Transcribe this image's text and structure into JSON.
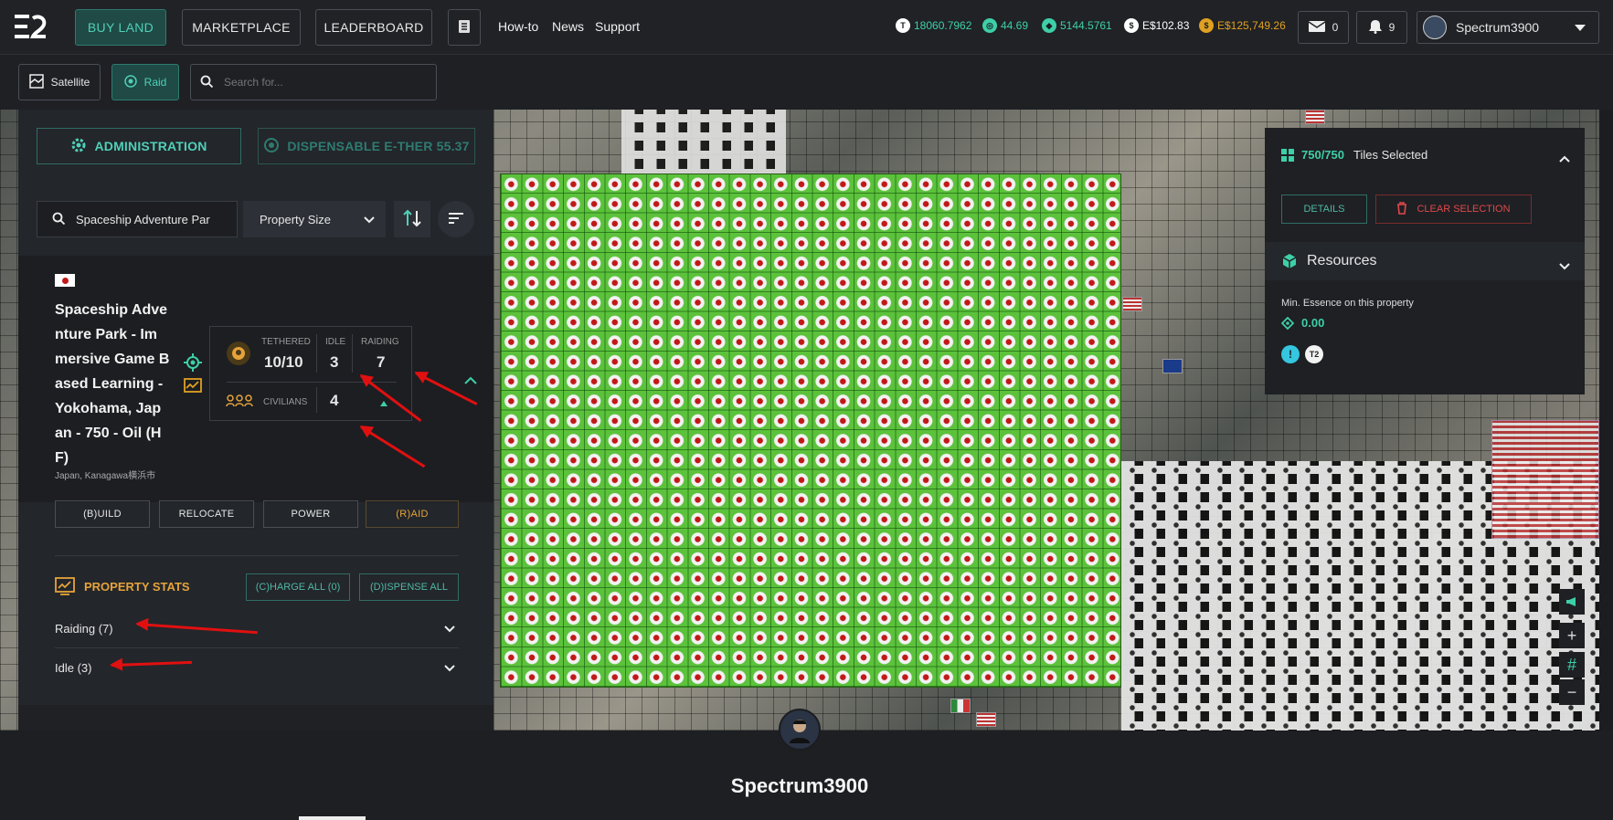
{
  "nav": {
    "logo": "E2",
    "buy_land": "BUY LAND",
    "marketplace": "MARKETPLACE",
    "leaderboard": "LEADERBOARD",
    "howto": "How-to",
    "news": "News",
    "support": "Support",
    "balances": [
      {
        "icon": "tile-token-icon",
        "badge": "T",
        "value": "18060.7962",
        "color": "#3ecfa8"
      },
      {
        "icon": "gem-token-icon",
        "badge": "◎",
        "value": "44.69",
        "color": "#3ecfa8"
      },
      {
        "icon": "essence-icon",
        "badge": "◆",
        "value": "5144.5761",
        "color": "#3ecfa8"
      },
      {
        "icon": "dollar-icon",
        "badge": "$",
        "value": "E$102.83",
        "color": "#ffffff"
      },
      {
        "icon": "gold-coin-icon",
        "badge": "$",
        "value": "E$125,749.26",
        "color": "#e0a020"
      }
    ],
    "mail_count": "0",
    "notif_count": "9",
    "username": "Spectrum3900"
  },
  "subbar": {
    "satellite": "Satellite",
    "raid": "Raid",
    "search_placeholder": "Search for..."
  },
  "panel": {
    "administration": "ADMINISTRATION",
    "dispensable": "DISPENSABLE E-THER 55.37",
    "search_value": "Spaceship Adventure Par",
    "size_select": "Property Size",
    "property": {
      "title_lines": [
        "Spaceship Adve",
        "nture Park - Im",
        "mersive Game B",
        "ased Learning -",
        "Yokohama, Jap",
        "an - 750 - Oil (H",
        "F)"
      ],
      "location": "Japan, Kanagawa横浜市"
    },
    "stats": {
      "tethered_label": "TETHERED",
      "tethered": "10/10",
      "idle_label": "IDLE",
      "idle": "3",
      "raiding_label": "RAIDING",
      "raiding": "7",
      "civilians_label": "CIVILIANS",
      "civilians": "4"
    },
    "actions": {
      "build": "(B)UILD",
      "relocate": "RELOCATE",
      "power": "POWER",
      "raid": "(R)AID"
    },
    "property_stats": "PROPERTY STATS",
    "charge_all": "(C)HARGE ALL (0)",
    "dispense_all": "(D)ISPENSE ALL",
    "rows": [
      {
        "label": "Raiding (7)"
      },
      {
        "label": "Idle (3)"
      }
    ]
  },
  "right": {
    "tiles_count": "750/750",
    "tiles_label": "Tiles Selected",
    "details": "DETAILS",
    "clear": "CLEAR SELECTION",
    "resources": "Resources",
    "min_essence_label": "Min. Essence on this property",
    "min_essence": "0.00",
    "tier": "T2"
  },
  "profile": {
    "name": "Spectrum3900"
  },
  "colors": {
    "accent": "#3ecfa8",
    "raid": "#e5a33a",
    "danger": "#e04848",
    "gold": "#e0a020"
  }
}
